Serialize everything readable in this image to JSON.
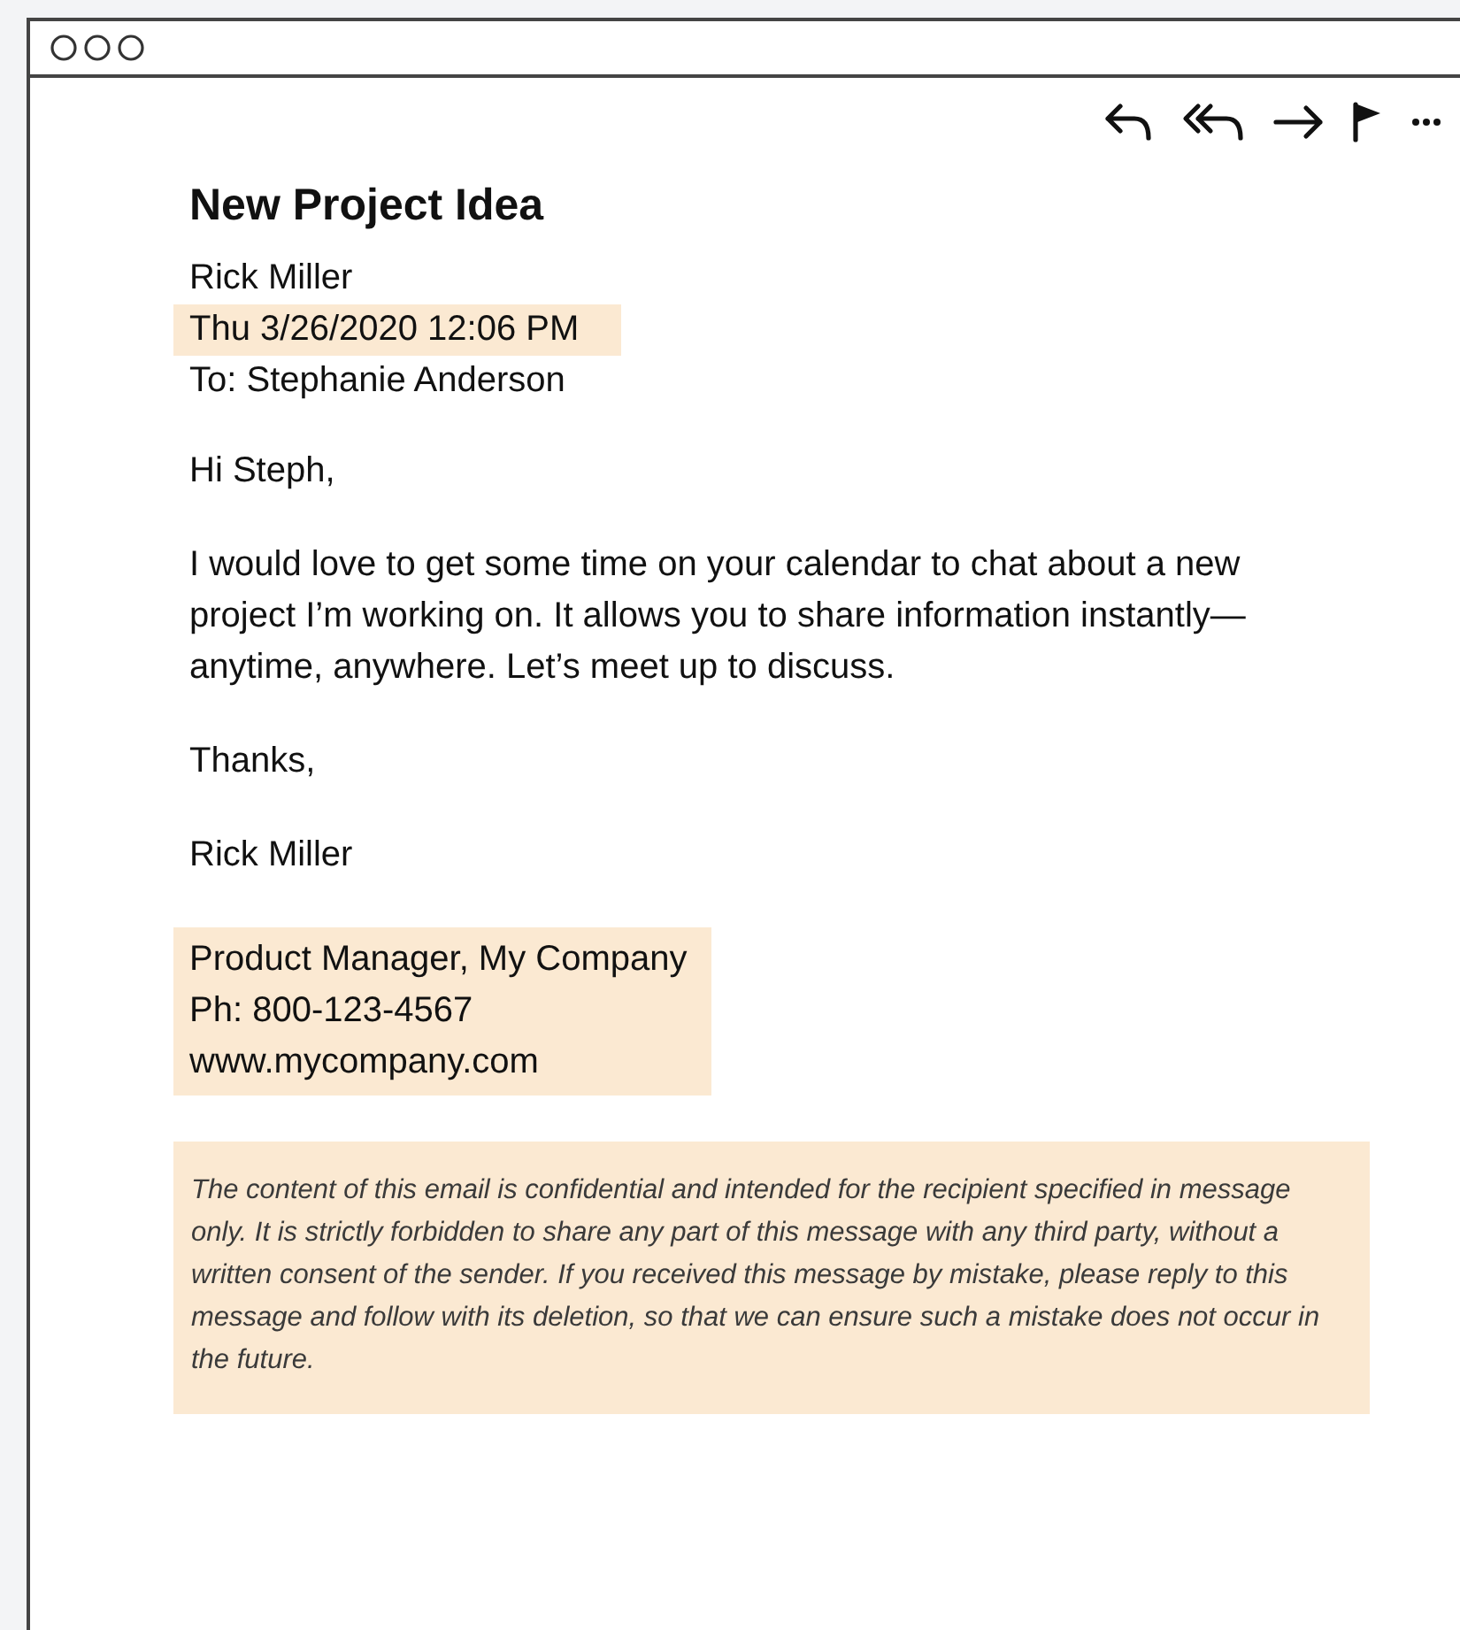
{
  "email": {
    "subject": "New Project Idea",
    "sender": "Rick Miller",
    "date": "Thu 3/26/2020 12:06 PM",
    "date_highlighted": true,
    "to": "To: Stephanie Anderson",
    "body": [
      "Hi Steph,",
      "I would love to get some time on your calendar to chat about a new project I’m working on. It allows you to share information instantly—anytime, anywhere. Let’s meet up to discuss.",
      "Thanks,",
      "Rick Miller"
    ],
    "signature": {
      "highlighted": true,
      "lines": [
        "Product Manager, My Company",
        "Ph: 800-123-4567",
        "www.mycompany.com"
      ]
    },
    "disclaimer": "The content of this email is confidential and intended for the recipient specified in message only. It is strictly forbidden to share any part of this message with any third party, without a written consent of the sender. If you received this message by mistake, please reply to this message and follow with its deletion, so that we can ensure such a mistake does not occur in the future."
  }
}
